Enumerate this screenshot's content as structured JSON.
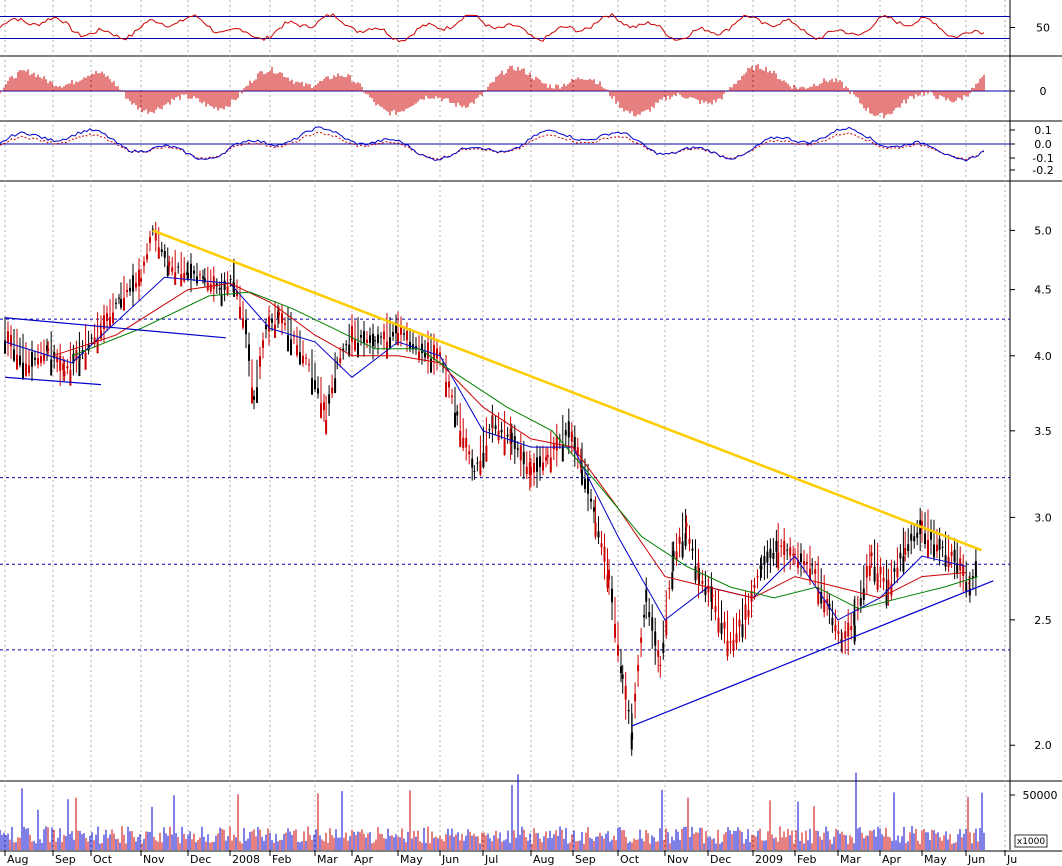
{
  "chart_data": {
    "type": "line",
    "x_months": [
      "Aug",
      "Sep",
      "Oct",
      "Nov",
      "Dec",
      "2008",
      "Feb",
      "Mar",
      "Apr",
      "May",
      "Jun",
      "Jul",
      "Aug",
      "Sep",
      "Oct",
      "Nov",
      "Dec",
      "2009",
      "Feb",
      "Mar",
      "Apr",
      "May",
      "Jun",
      "Ju"
    ],
    "panels": [
      {
        "name": "rsi",
        "ticks": [
          "50"
        ],
        "levels": [
          30,
          70
        ]
      },
      {
        "name": "momentum",
        "ticks": [
          "0"
        ]
      },
      {
        "name": "oscillator",
        "ticks": [
          "0.1",
          "0.0",
          "-0.1",
          "-0.2"
        ]
      },
      {
        "name": "price",
        "ticks": [
          "5.0",
          "4.5",
          "4.0",
          "3.5",
          "3.0",
          "2.5",
          "2.0"
        ],
        "scale": "log",
        "ylim": [
          1.88,
          5.45
        ],
        "horizontal_levels": [
          4.27,
          3.22,
          2.76,
          2.37
        ]
      },
      {
        "name": "volume",
        "ticks": [
          "50000"
        ],
        "multiplier": "x1000"
      }
    ],
    "price_series": [
      {
        "month": 0.0,
        "close": 4.15
      },
      {
        "month": 0.5,
        "close": 3.95
      },
      {
        "month": 0.9,
        "close": 4.05
      },
      {
        "month": 1.3,
        "close": 3.9
      },
      {
        "month": 1.7,
        "close": 4.02
      },
      {
        "month": 2.2,
        "close": 4.2
      },
      {
        "month": 2.6,
        "close": 4.45
      },
      {
        "month": 3.0,
        "close": 4.6
      },
      {
        "month": 3.25,
        "close": 5.0
      },
      {
        "month": 3.6,
        "close": 4.7
      },
      {
        "month": 4.0,
        "close": 4.65
      },
      {
        "month": 4.4,
        "close": 4.6
      },
      {
        "month": 4.8,
        "close": 4.5
      },
      {
        "month": 5.1,
        "close": 4.6
      },
      {
        "month": 5.4,
        "close": 4.2
      },
      {
        "month": 5.6,
        "close": 3.7
      },
      {
        "month": 5.9,
        "close": 4.2
      },
      {
        "month": 6.2,
        "close": 4.3
      },
      {
        "month": 6.6,
        "close": 4.1
      },
      {
        "month": 7.0,
        "close": 3.85
      },
      {
        "month": 7.3,
        "close": 3.6
      },
      {
        "month": 7.6,
        "close": 3.95
      },
      {
        "month": 8.0,
        "close": 4.15
      },
      {
        "month": 8.5,
        "close": 4.1
      },
      {
        "month": 9.0,
        "close": 4.2
      },
      {
        "month": 9.5,
        "close": 4.05
      },
      {
        "month": 10.0,
        "close": 4.0
      },
      {
        "month": 10.4,
        "close": 3.6
      },
      {
        "month": 10.8,
        "close": 3.25
      },
      {
        "month": 11.2,
        "close": 3.55
      },
      {
        "month": 11.6,
        "close": 3.45
      },
      {
        "month": 12.0,
        "close": 3.25
      },
      {
        "month": 12.4,
        "close": 3.35
      },
      {
        "month": 12.9,
        "close": 3.5
      },
      {
        "month": 13.2,
        "close": 3.3
      },
      {
        "month": 13.5,
        "close": 3.0
      },
      {
        "month": 13.8,
        "close": 2.7
      },
      {
        "month": 14.1,
        "close": 2.25
      },
      {
        "month": 14.3,
        "close": 2.05
      },
      {
        "month": 14.6,
        "close": 2.6
      },
      {
        "month": 14.9,
        "close": 2.3
      },
      {
        "month": 15.2,
        "close": 2.8
      },
      {
        "month": 15.5,
        "close": 2.95
      },
      {
        "month": 15.8,
        "close": 2.7
      },
      {
        "month": 16.1,
        "close": 2.6
      },
      {
        "month": 16.5,
        "close": 2.4
      },
      {
        "month": 16.9,
        "close": 2.55
      },
      {
        "month": 17.2,
        "close": 2.75
      },
      {
        "month": 17.6,
        "close": 2.85
      },
      {
        "month": 18.0,
        "close": 2.8
      },
      {
        "month": 18.4,
        "close": 2.75
      },
      {
        "month": 18.8,
        "close": 2.55
      },
      {
        "month": 19.1,
        "close": 2.4
      },
      {
        "month": 19.4,
        "close": 2.5
      },
      {
        "month": 19.8,
        "close": 2.8
      },
      {
        "month": 20.2,
        "close": 2.65
      },
      {
        "month": 20.6,
        "close": 2.85
      },
      {
        "month": 21.0,
        "close": 2.95
      },
      {
        "month": 21.4,
        "close": 2.85
      },
      {
        "month": 21.8,
        "close": 2.78
      },
      {
        "month": 22.1,
        "close": 2.65
      },
      {
        "month": 22.3,
        "close": 2.75
      }
    ],
    "moving_averages": [
      {
        "color": "#0000cc",
        "points": [
          [
            0,
            4.1
          ],
          [
            1.5,
            3.95
          ],
          [
            3.5,
            4.6
          ],
          [
            5,
            4.55
          ],
          [
            6,
            4.2
          ],
          [
            7,
            4.1
          ],
          [
            8,
            3.85
          ],
          [
            9,
            4.1
          ],
          [
            10,
            4.0
          ],
          [
            11,
            3.5
          ],
          [
            12,
            3.4
          ],
          [
            13,
            3.4
          ],
          [
            14,
            2.9
          ],
          [
            15,
            2.5
          ],
          [
            16,
            2.65
          ],
          [
            17,
            2.6
          ],
          [
            18,
            2.8
          ],
          [
            19,
            2.5
          ],
          [
            20,
            2.6
          ],
          [
            21,
            2.8
          ],
          [
            22,
            2.75
          ]
        ]
      },
      {
        "color": "#cc0000",
        "points": [
          [
            1,
            4.0
          ],
          [
            2.5,
            4.15
          ],
          [
            4,
            4.5
          ],
          [
            5,
            4.55
          ],
          [
            6,
            4.4
          ],
          [
            7,
            4.15
          ],
          [
            8,
            4.0
          ],
          [
            9,
            4.0
          ],
          [
            10,
            3.95
          ],
          [
            11,
            3.65
          ],
          [
            12,
            3.45
          ],
          [
            13,
            3.4
          ],
          [
            14,
            3.05
          ],
          [
            15,
            2.7
          ],
          [
            16,
            2.65
          ],
          [
            17,
            2.6
          ],
          [
            18,
            2.7
          ],
          [
            19,
            2.65
          ],
          [
            20,
            2.6
          ],
          [
            21,
            2.7
          ],
          [
            22,
            2.72
          ]
        ]
      },
      {
        "color": "#008000",
        "points": [
          [
            1.5,
            4.0
          ],
          [
            3,
            4.2
          ],
          [
            4.5,
            4.45
          ],
          [
            5.5,
            4.48
          ],
          [
            6.5,
            4.35
          ],
          [
            7.5,
            4.2
          ],
          [
            8.5,
            4.05
          ],
          [
            9.5,
            4.05
          ],
          [
            10.5,
            3.85
          ],
          [
            11.5,
            3.65
          ],
          [
            12.5,
            3.5
          ],
          [
            13.5,
            3.2
          ],
          [
            14.5,
            2.9
          ],
          [
            15.5,
            2.75
          ],
          [
            16.5,
            2.65
          ],
          [
            17.5,
            2.6
          ],
          [
            18.5,
            2.65
          ],
          [
            19.5,
            2.55
          ],
          [
            20.5,
            2.6
          ],
          [
            21.5,
            2.65
          ],
          [
            22.3,
            2.7
          ]
        ]
      }
    ],
    "trendlines": [
      {
        "color": "#ffcc00",
        "from": [
          3.25,
          5.0
        ],
        "to": [
          22.4,
          2.83
        ]
      },
      {
        "color": "#0000cc",
        "from": [
          14.3,
          2.07
        ],
        "to": [
          22.7,
          2.68
        ]
      },
      {
        "color": "#0000cc",
        "from": [
          0.0,
          4.28
        ],
        "to": [
          4.9,
          4.13
        ]
      },
      {
        "color": "#0000cc",
        "from": [
          0.0,
          3.85
        ],
        "to": [
          2.2,
          3.8
        ]
      }
    ],
    "grid": true
  }
}
